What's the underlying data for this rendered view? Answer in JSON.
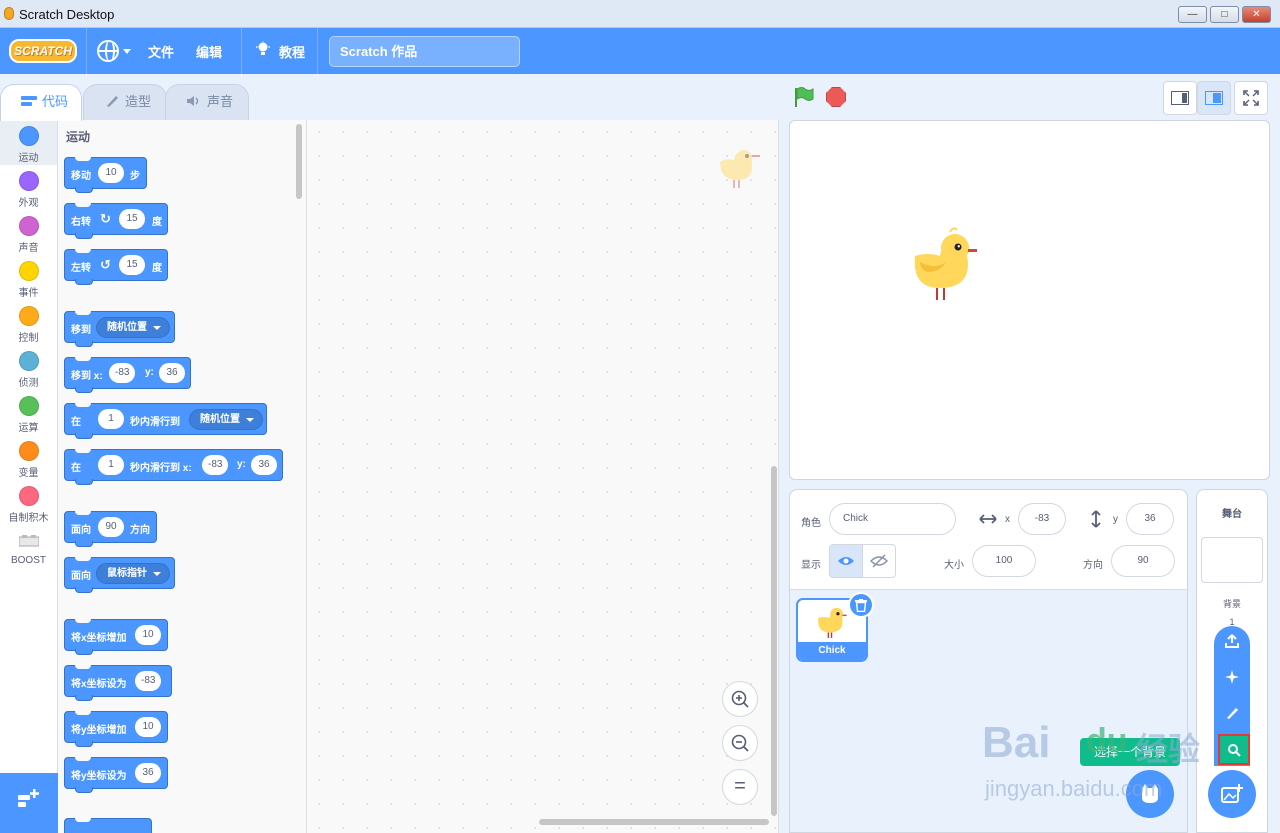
{
  "window": {
    "title": "Scratch Desktop",
    "minimize": "—",
    "maximize": "□",
    "close": "✕"
  },
  "menubar": {
    "logo": "SCRATCH",
    "file": "文件",
    "edit": "编辑",
    "tutorials": "教程",
    "project_title": "Scratch 作品"
  },
  "tabs": {
    "code": "代码",
    "costumes": "造型",
    "sounds": "声音"
  },
  "categories": [
    {
      "label": "运动",
      "color": "#4c97ff"
    },
    {
      "label": "外观",
      "color": "#9966ff"
    },
    {
      "label": "声音",
      "color": "#cf63cf"
    },
    {
      "label": "事件",
      "color": "#ffd500"
    },
    {
      "label": "控制",
      "color": "#ffab19"
    },
    {
      "label": "侦测",
      "color": "#5cb1d6"
    },
    {
      "label": "运算",
      "color": "#59c059"
    },
    {
      "label": "变量",
      "color": "#ff8c1a"
    },
    {
      "label": "自制积木",
      "color": "#ff6680"
    },
    {
      "label": "BOOST",
      "color": ""
    }
  ],
  "palette": {
    "section_title": "运动",
    "move": {
      "text": "移动",
      "steps": "10",
      "unit": "步"
    },
    "turn_right": {
      "text": "右转",
      "degrees": "15",
      "unit": "度"
    },
    "turn_left": {
      "text": "左转",
      "degrees": "15",
      "unit": "度"
    },
    "goto": {
      "text": "移到",
      "target": "随机位置"
    },
    "goto_xy": {
      "text": "移到 x:",
      "x": "-83",
      "ylabel": "y:",
      "y": "36"
    },
    "glide_to": {
      "text1": "在",
      "secs": "1",
      "text2": "秒内滑行到",
      "target": "随机位置"
    },
    "glide_xy": {
      "text1": "在",
      "secs": "1",
      "text2": "秒内滑行到 x:",
      "x": "-83",
      "ylabel": "y:",
      "y": "36"
    },
    "point_dir": {
      "text1": "面向",
      "dir": "90",
      "text2": "方向"
    },
    "point_towards": {
      "text": "面向",
      "target": "鼠标指针"
    },
    "change_x": {
      "text": "将x坐标增加",
      "value": "10"
    },
    "set_x": {
      "text": "将x坐标设为",
      "value": "-83"
    },
    "change_y": {
      "text": "将y坐标增加",
      "value": "10"
    },
    "set_y": {
      "text": "将y坐标设为",
      "value": "36"
    }
  },
  "zoom": {
    "in": "+",
    "out": "−",
    "reset": "="
  },
  "sprite_info": {
    "sprite_label": "角色",
    "sprite_name": "Chick",
    "x_label": "x",
    "x": "-83",
    "y_label": "y",
    "y": "36",
    "show_label": "显示",
    "size_label": "大小",
    "size": "100",
    "direction_label": "方向",
    "direction": "90"
  },
  "sprites": [
    {
      "name": "Chick",
      "selected": true
    }
  ],
  "stage_pane": {
    "title": "舞台",
    "backdrops_label": "背景",
    "backdrops_count": "1"
  },
  "backdrop_tooltip": "选择一个背景",
  "watermark": {
    "brand": "Bai",
    "du": "du",
    "jingyan": "经验",
    "url": "jingyan.baidu.com"
  }
}
